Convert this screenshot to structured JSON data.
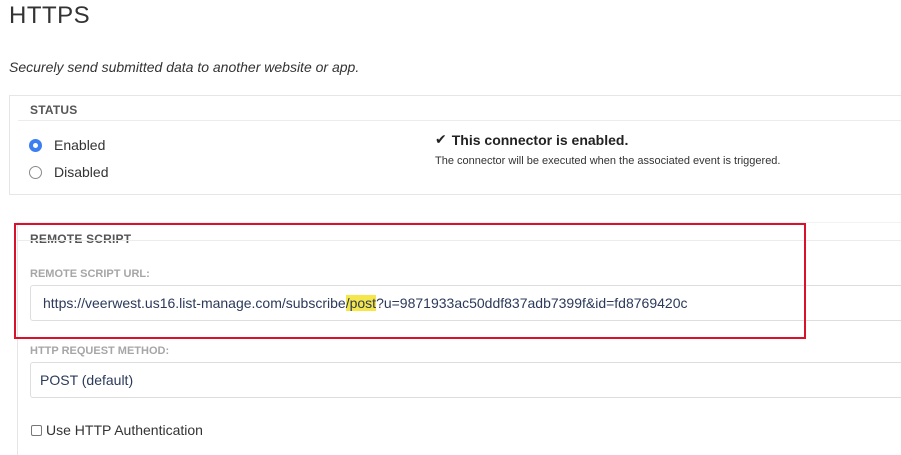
{
  "page": {
    "title": "HTTPS",
    "subtitle": "Securely send submitted data to another website or app."
  },
  "status": {
    "legend": "STATUS",
    "options": [
      {
        "label": "Enabled",
        "selected": true
      },
      {
        "label": "Disabled",
        "selected": false
      }
    ],
    "message_title": "This connector is enabled.",
    "message_icon": "check-icon",
    "message_detail": "The connector will be executed when the associated event is triggered."
  },
  "remote_script": {
    "legend": "REMOTE SCRIPT",
    "url_label": "REMOTE SCRIPT URL:",
    "url_value_before": "https://veerwest.us16.list-manage.com/subscribe",
    "url_value_highlight": "/post",
    "url_value_after": "?u=9871933ac50ddf837adb7399f&id=fd8769420c",
    "method_label": "HTTP REQUEST METHOD:",
    "method_value": "POST (default)",
    "auth_label": "Use HTTP Authentication",
    "auth_checked": false
  },
  "colors": {
    "annotation_border": "#d9112d",
    "text_highlight": "#f5e64a",
    "radio_selected": "#3b7ff2"
  }
}
